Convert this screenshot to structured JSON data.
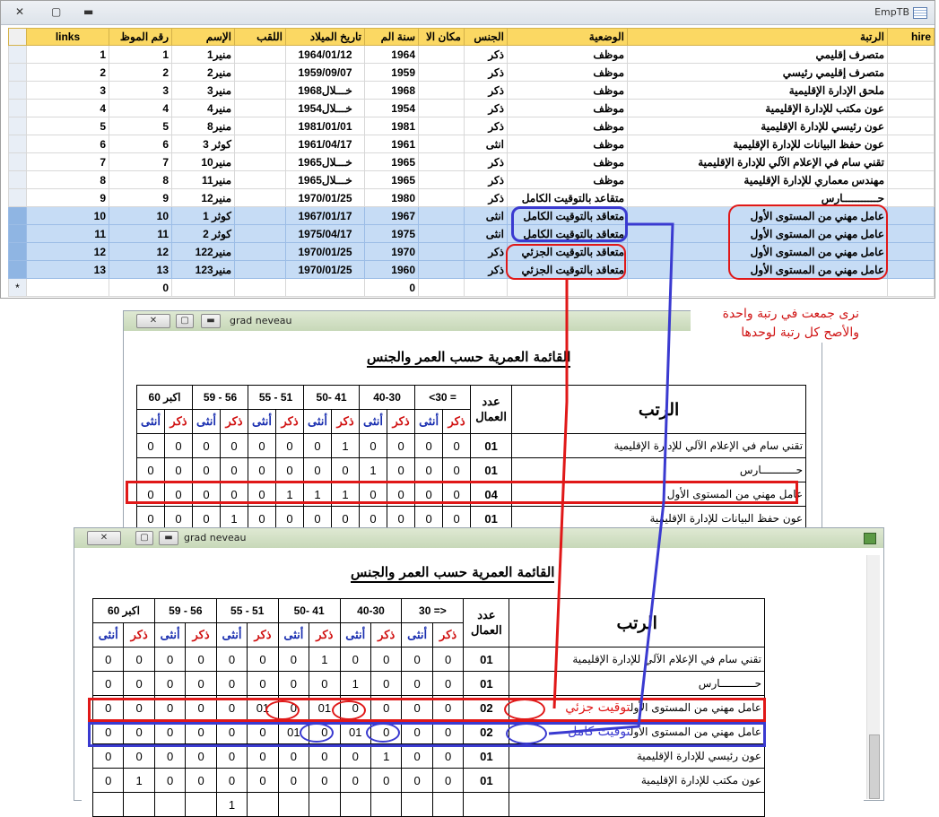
{
  "datasheet": {
    "title": "EmpTB",
    "columns": [
      "links",
      "رقم الموظ",
      "الإسم",
      "اللقب",
      "تاريخ الميلاد",
      "سنة الم",
      "مكان الا",
      "الجنس",
      "الوضعية",
      "الرتبة",
      "hire"
    ],
    "rows": [
      {
        "links": "1",
        "id": "1",
        "name": "منير1",
        "lastname": "",
        "birth": "1964/01/12",
        "year": "1964",
        "place": "",
        "gender": "ذكر",
        "status": "موظف",
        "rank": "متصرف إقليمي"
      },
      {
        "links": "2",
        "id": "2",
        "name": "منير2",
        "lastname": "",
        "birth": "1959/09/07",
        "year": "1959",
        "place": "",
        "gender": "ذكر",
        "status": "موظف",
        "rank": "متصرف إقليمي رئيسي"
      },
      {
        "links": "3",
        "id": "3",
        "name": "منير3",
        "lastname": "",
        "birth": "خـــلال1968",
        "year": "1968",
        "place": "",
        "gender": "ذكر",
        "status": "موظف",
        "rank": "ملحق الإدارة الإقليمية"
      },
      {
        "links": "4",
        "id": "4",
        "name": "منير4",
        "lastname": "",
        "birth": "خـــلال1954",
        "year": "1954",
        "place": "",
        "gender": "ذكر",
        "status": "موظف",
        "rank": "عون مكتب للإدارة الإقليمية"
      },
      {
        "links": "5",
        "id": "5",
        "name": "منير8",
        "lastname": "",
        "birth": "1981/01/01",
        "year": "1981",
        "place": "",
        "gender": "ذكر",
        "status": "موظف",
        "rank": "عون رئيسي للإدارة الإقليمية"
      },
      {
        "links": "6",
        "id": "6",
        "name": "كوثر 3",
        "lastname": "",
        "birth": "1961/04/17",
        "year": "1961",
        "place": "",
        "gender": "انثى",
        "status": "موظف",
        "rank": "عون حفظ البيانات للإدارة الإقليمية"
      },
      {
        "links": "7",
        "id": "7",
        "name": "منير10",
        "lastname": "",
        "birth": "خـــلال1965",
        "year": "1965",
        "place": "",
        "gender": "ذكر",
        "status": "موظف",
        "rank": "تقني سام في الإعلام الآلي للإدارة الإقليمية"
      },
      {
        "links": "8",
        "id": "8",
        "name": "منير11",
        "lastname": "",
        "birth": "خـــلال1965",
        "year": "1965",
        "place": "",
        "gender": "ذكر",
        "status": "موظف",
        "rank": "مهندس معماري للإدارة الإقليمية"
      },
      {
        "links": "9",
        "id": "9",
        "name": "منير12",
        "lastname": "",
        "birth": "1970/01/25",
        "year": "1980",
        "place": "",
        "gender": "ذكر",
        "status": "متقاعد بالتوقيت الكامل",
        "rank": "حـــــــــــارس"
      },
      {
        "links": "10",
        "id": "10",
        "name": "كوثر 1",
        "lastname": "",
        "birth": "1967/01/17",
        "year": "1967",
        "place": "",
        "gender": "انثى",
        "status": "متعاقد بالتوقيت الكامل",
        "rank": "عامل مهني من المستوى الأول"
      },
      {
        "links": "11",
        "id": "11",
        "name": "كوثر 2",
        "lastname": "",
        "birth": "1975/04/17",
        "year": "1975",
        "place": "",
        "gender": "انثى",
        "status": "متعاقد بالتوقيت الكامل",
        "rank": "عامل مهني من المستوى الأول"
      },
      {
        "links": "12",
        "id": "12",
        "name": "منير122",
        "lastname": "",
        "birth": "1970/01/25",
        "year": "1970",
        "place": "",
        "gender": "ذكر",
        "status": "متعاقد بالتوقيت الجزئي",
        "rank": "عامل مهني من المستوى الأول"
      },
      {
        "links": "13",
        "id": "13",
        "name": "منير123",
        "lastname": "",
        "birth": "1970/01/25",
        "year": "1960",
        "place": "",
        "gender": "ذكر",
        "status": "متعاقد بالتوقيت الجزئي",
        "rank": "عامل مهني من المستوى الأول"
      }
    ],
    "new_row": {
      "marker": "*",
      "id": "0",
      "year": "0"
    }
  },
  "note": {
    "line1": "نرى جمعت في رتبة واحدة",
    "line2": "والأصح كل رتبة لوحدها"
  },
  "report": {
    "window_title": "grad neveau",
    "heading": "القائمة العمرية حسب العمر والجنس",
    "rank_header": "الرتب",
    "count_header": "عدد العمال",
    "age_groups": [
      "60 اكبر",
      "59 - 56",
      "55 - 51",
      "50- 41",
      "40-30",
      "30 =>"
    ],
    "male": "ذكر",
    "female": "أنثى"
  },
  "report1": {
    "heading": "القائمة العمرية حسب العمر والجنس",
    "age_groups": [
      "60 اكبر",
      "59 - 56",
      "55 - 51",
      "50- 41",
      "40-30",
      "<30 ="
    ],
    "rows": [
      {
        "name": "تقني سام في الإعلام الآلي للإدارة الإقليمية",
        "count": "01",
        "vals": [
          "0",
          "0",
          "0",
          "0",
          "0",
          "0",
          "0",
          "1",
          "0",
          "0",
          "0",
          "0"
        ]
      },
      {
        "name": "حـــــــــــارس",
        "count": "01",
        "vals": [
          "0",
          "0",
          "0",
          "0",
          "0",
          "0",
          "0",
          "0",
          "1",
          "0",
          "0",
          "0"
        ]
      },
      {
        "name": "عامل مهني من المستوى الأول",
        "count": "04",
        "vals": [
          "0",
          "0",
          "0",
          "0",
          "0",
          "1",
          "1",
          "1",
          "0",
          "0",
          "0",
          "0"
        ]
      },
      {
        "name": "عون حفظ البيانات للإدارة الإقليمية",
        "count": "01",
        "vals": [
          "0",
          "0",
          "0",
          "1",
          "0",
          "0",
          "0",
          "0",
          "0",
          "0",
          "0",
          "0"
        ]
      }
    ]
  },
  "report2": {
    "rows": [
      {
        "name": "تقني سام في الإعلام الآلي للإدارة الإقليمية",
        "suffix": "",
        "count": "01",
        "vals": [
          "0",
          "0",
          "0",
          "0",
          "0",
          "0",
          "0",
          "1",
          "0",
          "0",
          "0",
          "0"
        ]
      },
      {
        "name": "حـــــــــــارس",
        "suffix": "",
        "count": "01",
        "vals": [
          "0",
          "0",
          "0",
          "0",
          "0",
          "0",
          "0",
          "0",
          "1",
          "0",
          "0",
          "0"
        ]
      },
      {
        "name": "عامل مهني من المستوى الأول",
        "suffix": "توقيت جزئي",
        "count": "02",
        "vals": [
          "0",
          "0",
          "0",
          "0",
          "0",
          "01",
          "0",
          "01",
          "0",
          "0",
          "0",
          "0"
        ]
      },
      {
        "name": "عامل مهني من المستوى الأول",
        "suffix": "توقيت كامل",
        "count": "02",
        "vals": [
          "0",
          "0",
          "0",
          "0",
          "0",
          "0",
          "01",
          "0",
          "01",
          "0",
          "0",
          "0"
        ]
      },
      {
        "name": "عون رئيسي للإدارة الإقليمية",
        "suffix": "",
        "count": "01",
        "vals": [
          "0",
          "0",
          "0",
          "0",
          "0",
          "0",
          "0",
          "0",
          "0",
          "1",
          "0",
          "0"
        ]
      },
      {
        "name": "عون مكتب للإدارة الإقليمية",
        "suffix": "",
        "count": "01",
        "vals": [
          "0",
          "1",
          "0",
          "0",
          "0",
          "0",
          "0",
          "0",
          "0",
          "0",
          "0",
          "0"
        ]
      },
      {
        "name": "",
        "suffix": "",
        "count": "",
        "vals": [
          "",
          "",
          "",
          "",
          "1",
          "",
          "",
          "",
          "",
          "",
          "",
          ""
        ]
      }
    ]
  },
  "colors": {
    "annot_red": "#e01818",
    "annot_blue": "#3a3ad0",
    "header_yellow": "#fbd863",
    "selection_blue": "#c6dcf5"
  }
}
